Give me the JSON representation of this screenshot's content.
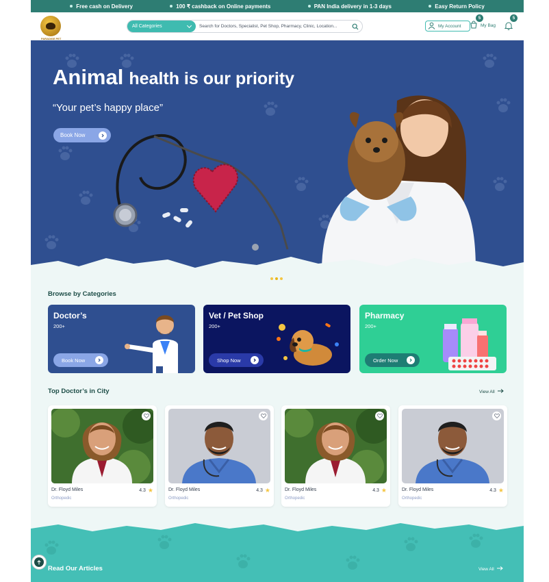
{
  "promo_bar": {
    "items": [
      "Free cash on Delivery",
      "100 ₹ cashback on Online payments",
      "PAN India delivery in 1-3 days",
      "Easy Return Policy"
    ]
  },
  "header": {
    "logo_text": "PARADISE PET",
    "category_select": "All Categories",
    "search_placeholder": "Search for Doctors, Specialist, Pet Shop, Pharmacy, Clinic, Location...",
    "account_label": "My Account",
    "bag_label": "My Bag",
    "bag_count": "5",
    "notification_count": "5",
    "icons": [
      "search-icon",
      "user-icon",
      "bag-icon",
      "bell-icon"
    ]
  },
  "hero": {
    "title_big": "Animal",
    "title_rest": "health is our priority",
    "quote": "“Your pet’s happy place”",
    "button_label": "Book Now",
    "background_color": "#2f4f90"
  },
  "categories": {
    "title": "Browse by Categories",
    "items": [
      {
        "name": "Doctor’s",
        "count": "200+",
        "button": "Book Now",
        "color": "#2f4f90",
        "button_color": "#8aa6e6"
      },
      {
        "name": "Vet / Pet Shop",
        "count": "200+",
        "button": "Shop Now",
        "color": "#0b1560",
        "button_color": "#2a3aa8"
      },
      {
        "name": "Pharmacy",
        "count": "200+",
        "button": "Order Now",
        "color": "#2fcf95",
        "button_color": "#1e7d74"
      }
    ]
  },
  "doctors": {
    "title": "Top Doctor’s in City",
    "view_all": "View All",
    "items": [
      {
        "name": "Dr. Floyd Miles",
        "rating": "4.3",
        "specialty": "Orthopedic"
      },
      {
        "name": "Dr. Floyd Miles",
        "rating": "4.3",
        "specialty": "Orthopedic"
      },
      {
        "name": "Dr. Floyd Miles",
        "rating": "4.3",
        "specialty": "Orthopedic"
      },
      {
        "name": "Dr. Floyd Miles",
        "rating": "4.3",
        "specialty": "Orthopedic"
      }
    ]
  },
  "articles": {
    "title": "Read Our Articles",
    "view_all": "View All",
    "background_color": "#44bfb6"
  },
  "colors": {
    "brand_dark": "#2e7d73",
    "brand_teal": "#3fbbb0",
    "star": "#f4c542"
  }
}
